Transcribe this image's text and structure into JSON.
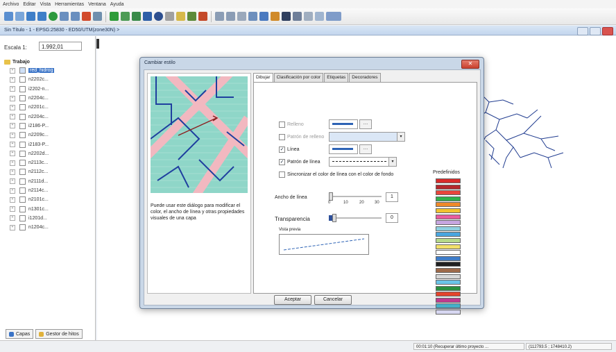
{
  "menu": [
    "Archivo",
    "Editar",
    "Vista",
    "Herramientas",
    "Ventana",
    "Ayuda"
  ],
  "document": {
    "title": "Sin Título - 1 - EPSG:25830 - ED50/UTM(zone30N) >"
  },
  "left_panel": {
    "scale_label": "Escala 1:",
    "scale_value": "1.992,01",
    "tree_root": "Trabajo",
    "layers": [
      "red_hidrog",
      "n2202c...",
      "i2202-n...",
      "n2204c...",
      "n2201c...",
      "n2204c...",
      "i2186-P...",
      "n2209c...",
      "i2183-P...",
      "n2202d...",
      "n2113c...",
      "n2112c...",
      "n2111d...",
      "n2114c...",
      "n2101c...",
      "n1301c...",
      "i1201d...",
      "n1204c..."
    ],
    "tabs": [
      "Capas",
      "Gestor de hitos"
    ]
  },
  "status": {
    "message": "00:01:10 (Recuperar último proyecto ...",
    "coords": "(112793.5 ; 1748410.2)"
  },
  "dialog": {
    "title": "Cambiar estilo",
    "description": "Puede usar este diálogo para modificar el color, el ancho de línea y otras propiedades visuales de una capa",
    "tabs": [
      "Dibujar",
      "Clasificación por color",
      "Etiquetas",
      "Decoradores"
    ],
    "relleno_label": "Relleno",
    "patron_relleno_label": "Patrón de relleno",
    "linea_label": "Línea",
    "patron_linea_label": "Patrón de línea",
    "sync_label": "Sincronizar el color de línea con el color de fondo",
    "ancho_label": "Ancho de línea",
    "ancho_ticks": [
      "0",
      "10",
      "20",
      "30"
    ],
    "ancho_value": "1",
    "transparencia_label": "Transparencia",
    "transparencia_value": "0",
    "vista_label": "Vista previa",
    "palette_title": "Predefinidos",
    "palette": [
      "#d92b2b",
      "#b5282d",
      "#e8463c",
      "#2fb04b",
      "#ef8a2a",
      "#f2c230",
      "#e85c9e",
      "#c7a6e0",
      "#8fd0e0",
      "#49a6e0",
      "#b6d98a",
      "#f2e06a",
      "#ffffff",
      "#3d7cc9",
      "#202020",
      "#9e6a4a",
      "#d7d7d7",
      "#6bc4e8",
      "#2a8f3f",
      "#e4432c",
      "#c03a8f",
      "#45b0c9",
      "#d6d6f0"
    ],
    "accept_label": "Aceptar",
    "cancel_label": "Cancelar"
  }
}
